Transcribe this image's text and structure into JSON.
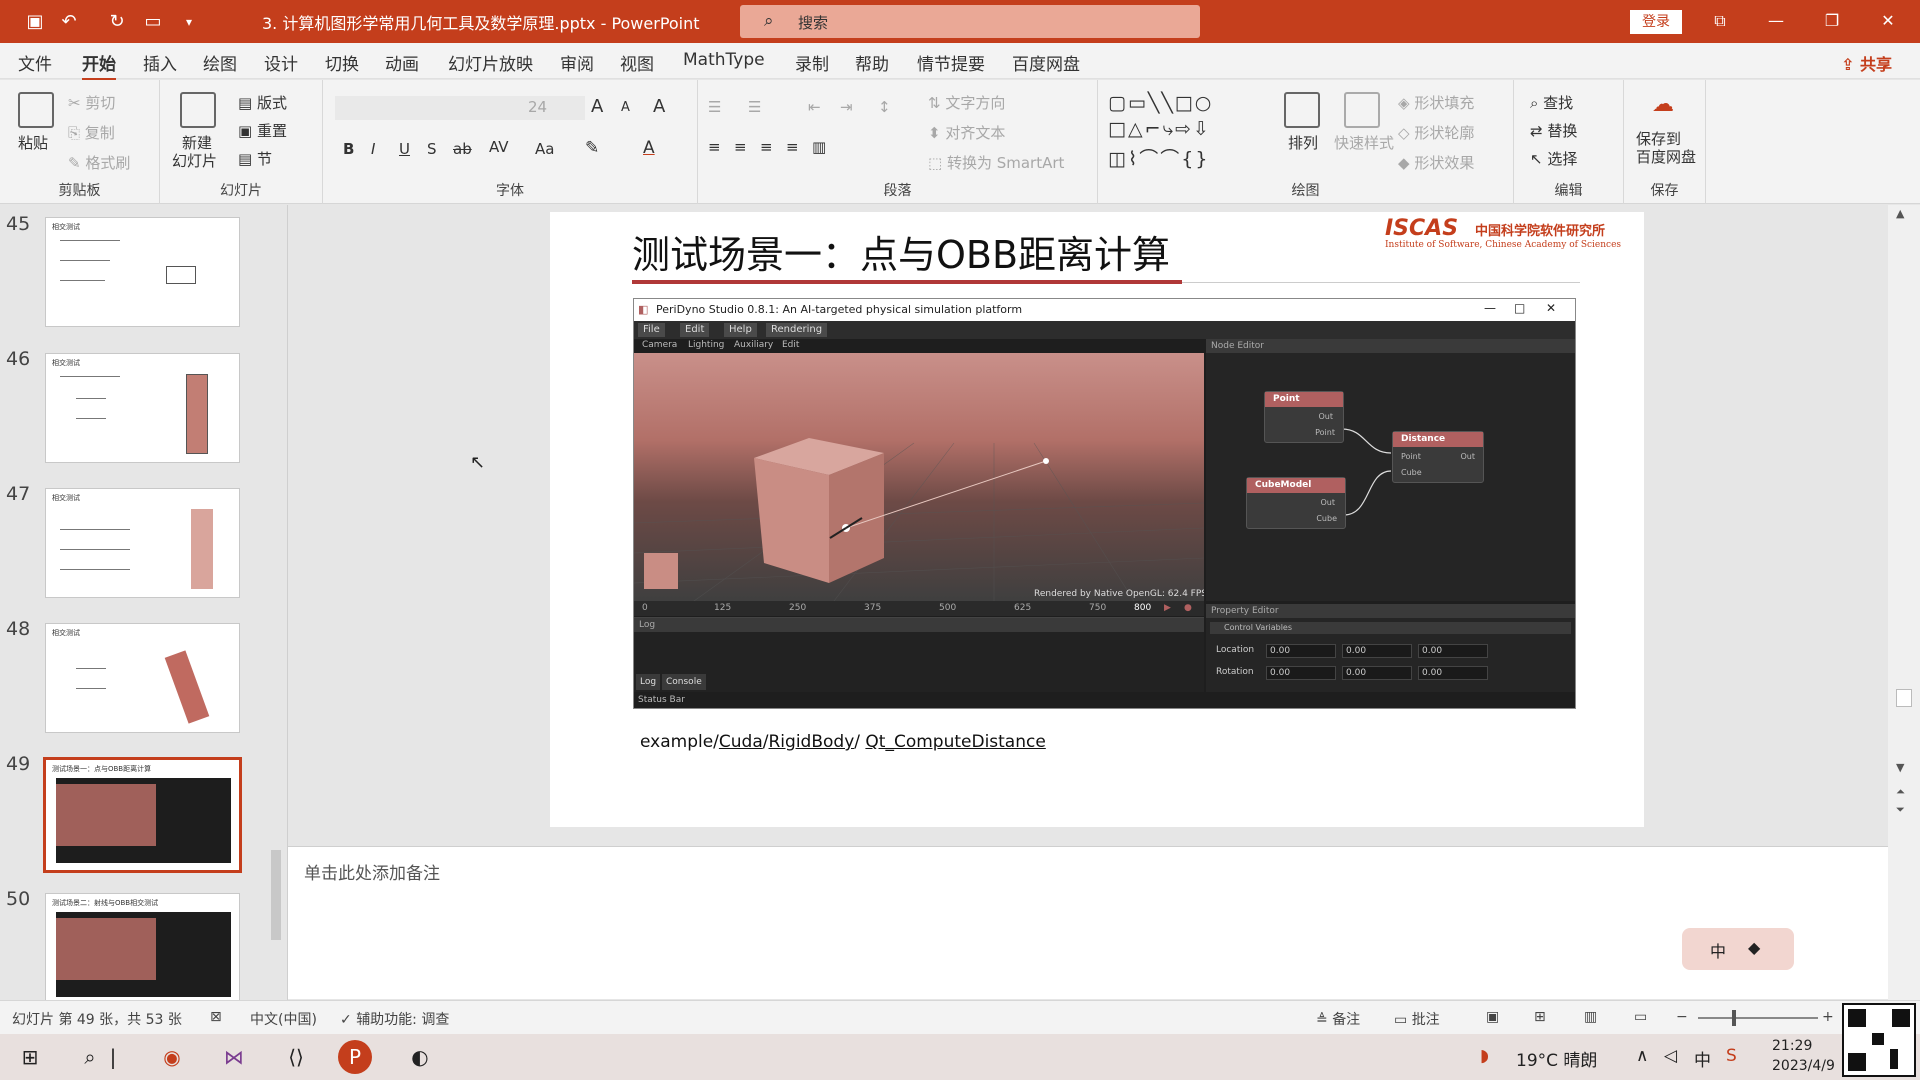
{
  "window": {
    "doc_title": "3. 计算机图形学常用几何工具及数学原理.pptx  -  PowerPoint",
    "search_placeholder": "搜索",
    "login": "登录"
  },
  "menu": {
    "items": [
      "文件",
      "开始",
      "插入",
      "绘图",
      "设计",
      "切换",
      "动画",
      "幻灯片放映",
      "审阅",
      "视图",
      "MathType",
      "录制",
      "帮助",
      "情节提要",
      "百度网盘"
    ],
    "share": "共享"
  },
  "ribbon": {
    "clipboard": {
      "paste": "粘贴",
      "cut": "剪切",
      "copy": "复制",
      "format_painter": "格式刷",
      "label": "剪贴板"
    },
    "slides": {
      "new_slide": "新建",
      "new_slide2": "幻灯片",
      "layout": "版式",
      "reset": "重置",
      "section": "节",
      "label": "幻灯片"
    },
    "font": {
      "size": "24",
      "bold": "B",
      "italic": "I",
      "underline": "U",
      "strike": "S",
      "strike2": "ab",
      "spacing": "AV",
      "case": "Aa",
      "label": "字体"
    },
    "paragraph": {
      "text_direction": "文字方向",
      "align_text": "对齐文本",
      "smartart": "转换为 SmartArt",
      "label": "段落"
    },
    "drawing": {
      "arrange": "排列",
      "quick_styles": "快速样式",
      "shape_fill": "形状填充",
      "shape_outline": "形状轮廓",
      "shape_effects": "形状效果",
      "label": "绘图"
    },
    "editing": {
      "find": "查找",
      "replace": "替换",
      "select": "选择",
      "label": "编辑"
    },
    "save": {
      "save_to": "保存到",
      "baidu": "百度网盘",
      "label": "保存"
    }
  },
  "thumbnails": [
    {
      "num": "45",
      "title": "相交测试"
    },
    {
      "num": "46",
      "title": "相交测试"
    },
    {
      "num": "47",
      "title": "相交测试"
    },
    {
      "num": "48",
      "title": "相交测试"
    },
    {
      "num": "49",
      "title": "测试场景一：点与OBB距离计算"
    },
    {
      "num": "50",
      "title": "测试场景二：射线与OBB相交测试"
    }
  ],
  "slide": {
    "title": "测试场景一：点与OBB距离计算",
    "logo_main": "ISCAS",
    "logo_cn": "中国科学院软件研究所",
    "logo_en": "Institute of Software, Chinese Academy of Sciences",
    "path_parts": [
      "example/",
      "Cuda",
      "/",
      "RigidBody",
      "/ ",
      "Qt_ComputeDistance"
    ]
  },
  "app": {
    "title": "PeriDyno Studio 0.8.1:  An AI-targeted physical simulation platform",
    "menu": [
      "File",
      "Edit",
      "Help",
      "Rendering"
    ],
    "submenu": [
      "Camera",
      "Lighting",
      "Auxiliary",
      "Edit"
    ],
    "render_info": "Rendered by Native OpenGL: 62.4 FPS",
    "timeline": [
      "0",
      "125",
      "250",
      "375",
      "500",
      "625",
      "750"
    ],
    "frame": "800",
    "node_editor": "Node Editor",
    "nodes": {
      "point": {
        "title": "Point",
        "out": "Out",
        "port": "Point"
      },
      "cube": {
        "title": "CubeModel",
        "out": "Out",
        "port": "Cube"
      },
      "distance": {
        "title": "Distance",
        "in1": "Point",
        "in2": "Cube",
        "out": "Out"
      }
    },
    "property_editor": "Property Editor",
    "control_vars": "Control Variables",
    "location_label": "Location",
    "rotation_label": "Rotation",
    "location": [
      "0.00",
      "0.00",
      "0.00"
    ],
    "rotation": [
      "0.00",
      "0.00",
      "0.00"
    ],
    "log_label": "Log",
    "log_tab": "Log",
    "console_tab": "Console",
    "status_bar": "Status Bar"
  },
  "notes_placeholder": "单击此处添加备注",
  "statusbar": {
    "slide_info": "幻灯片 第 49 张，共 53 张",
    "language": "中文(中国)",
    "accessibility": "辅助功能: 调查",
    "notes": "备注",
    "comments": "批注"
  },
  "ime": {
    "lang": "中"
  },
  "taskbar": {
    "weather": "19°C  晴朗",
    "ime": "中",
    "time": "21:29",
    "date": "2023/4/9"
  },
  "colors": {
    "accent": "#c43e1c",
    "node_header": "#b06060"
  }
}
